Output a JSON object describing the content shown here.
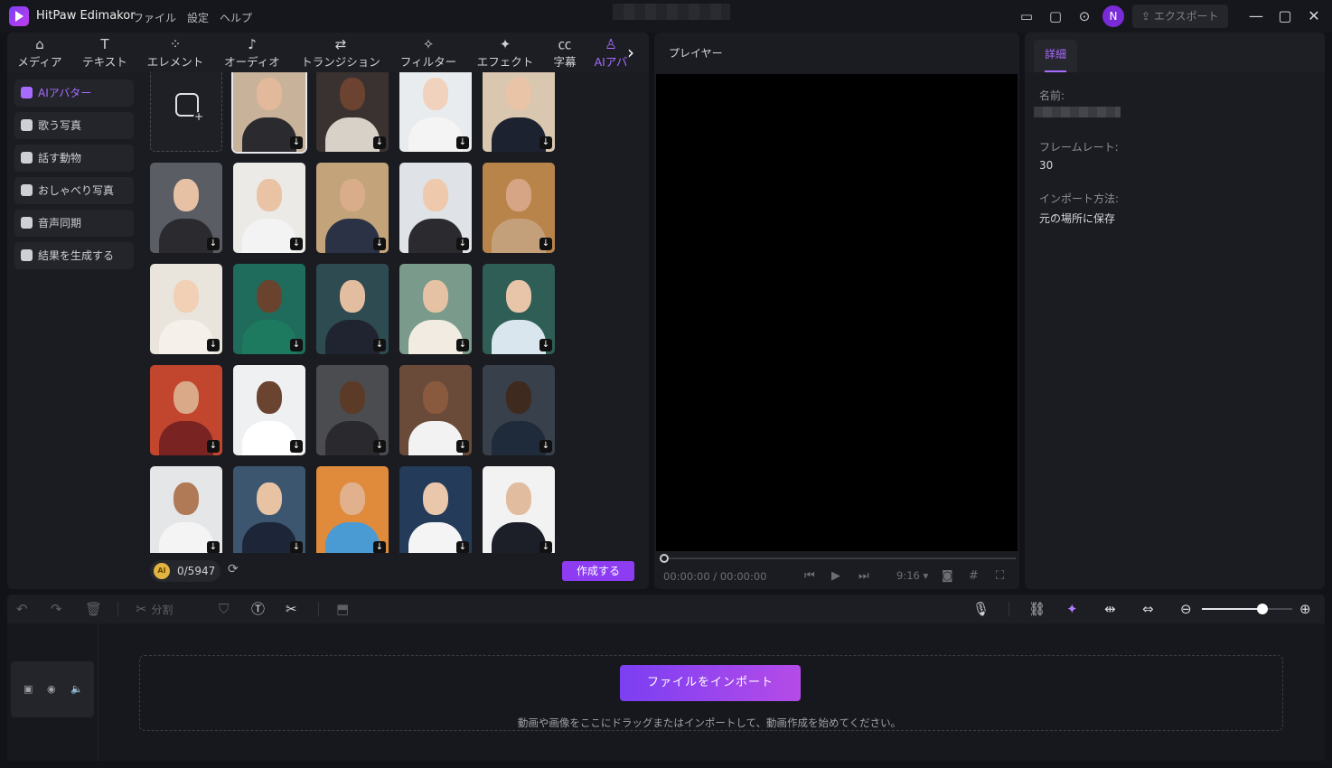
{
  "app": {
    "name": "HitPaw Edimakor"
  },
  "menu": [
    "ファイル",
    "設定",
    "ヘルプ"
  ],
  "titlebar": {
    "avatar_initial": "N",
    "export_label": "エクスポート"
  },
  "tabs": [
    {
      "label": "メディア",
      "icon": "media-icon"
    },
    {
      "label": "テキスト",
      "icon": "text-icon"
    },
    {
      "label": "エレメント",
      "icon": "elements-icon"
    },
    {
      "label": "オーディオ",
      "icon": "audio-icon"
    },
    {
      "label": "トランジション",
      "icon": "transition-icon"
    },
    {
      "label": "フィルター",
      "icon": "filter-icon"
    },
    {
      "label": "エフェクト",
      "icon": "effect-icon"
    },
    {
      "label": "字幕",
      "icon": "subtitle-icon"
    },
    {
      "label": "AIアバ",
      "icon": "ai-avatar-icon",
      "active": true
    }
  ],
  "sidebar": {
    "items": [
      {
        "label": "AIアバター",
        "active": true
      },
      {
        "label": "歌う写真"
      },
      {
        "label": "話す動物"
      },
      {
        "label": "おしゃべり写真"
      },
      {
        "label": "音声同期"
      },
      {
        "label": "結果を生成する"
      }
    ]
  },
  "avatars": {
    "count_visible": 24,
    "selected_index": 0
  },
  "footer": {
    "credits": "0/5947",
    "coin_label": "AI",
    "create_label": "作成する"
  },
  "player": {
    "title": "プレイヤー",
    "time": "00:00:00 / 00:00:00",
    "ratio": "9:16"
  },
  "details": {
    "tab": "詳細",
    "name_label": "名前:",
    "framerate_label": "フレームレート:",
    "framerate_value": "30",
    "import_label": "インポート方法:",
    "import_value": "元の場所に保存"
  },
  "timeline": {
    "split_label": "分割",
    "import_button": "ファイルをインポート",
    "drop_hint": "動画や画像をここにドラッグまたはインポートして、動画作成を始めてください。"
  },
  "colors": {
    "accent": "#8d3cf2",
    "active_text": "#a86bff",
    "bg": "#121318"
  }
}
